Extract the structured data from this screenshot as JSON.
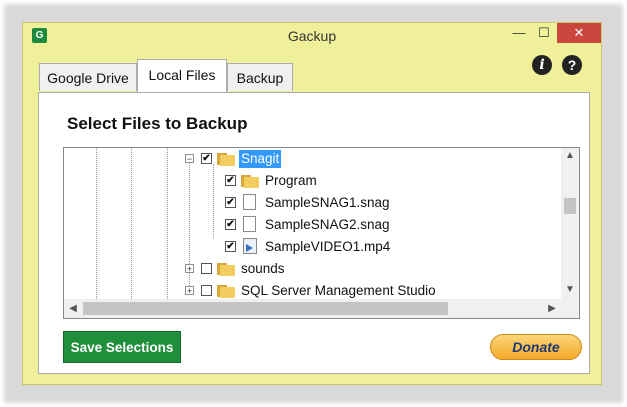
{
  "window": {
    "title": "Gackup",
    "app_icon": "G",
    "min_glyph": "—",
    "max_glyph": "☐",
    "close_glyph": "✕"
  },
  "tabs": [
    {
      "label": "Google Drive"
    },
    {
      "label": "Local Files",
      "active": true
    },
    {
      "label": "Backup"
    }
  ],
  "icons": {
    "info": "i",
    "help": "?"
  },
  "panel": {
    "heading": "Select Files to Backup"
  },
  "tree": {
    "items": [
      {
        "label": "Snagit",
        "type": "folder",
        "checked": true,
        "expanded": true,
        "selected": true
      },
      {
        "label": "Program",
        "type": "folder",
        "checked": true
      },
      {
        "label": "SampleSNAG1.snag",
        "type": "file",
        "checked": true
      },
      {
        "label": "SampleSNAG2.snag",
        "type": "file",
        "checked": true
      },
      {
        "label": "SampleVIDEO1.mp4",
        "type": "video",
        "checked": true
      },
      {
        "label": "sounds",
        "type": "folder",
        "checked": false,
        "expanded": false
      },
      {
        "label": "SQL Server Management Studio",
        "type": "folder",
        "checked": false,
        "expanded": false
      }
    ],
    "check_glyph": "✔",
    "expand_collapsed": "+",
    "expand_expanded": "−"
  },
  "scroll": {
    "up": "▲",
    "down": "▼",
    "left": "◀",
    "right": "▶"
  },
  "buttons": {
    "save": "Save Selections",
    "donate": "Donate"
  },
  "colors": {
    "title_bar": "#f0ef9a",
    "save_button": "#1f8f3c",
    "selection": "#3399ff",
    "close_button": "#c9463d"
  }
}
